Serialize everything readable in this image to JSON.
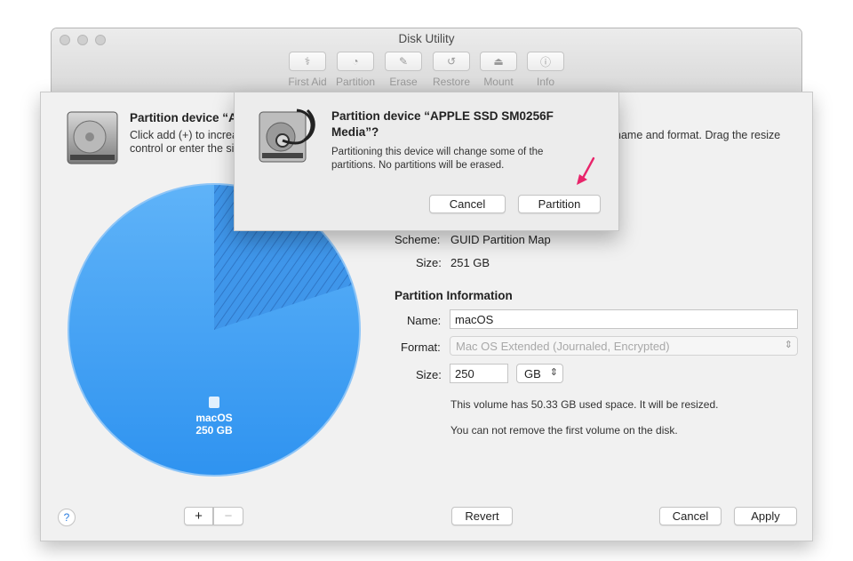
{
  "window": {
    "title": "Disk Utility",
    "toolbar": [
      {
        "label": "First Aid",
        "icon": "stethoscope-icon",
        "glyph": "⚕"
      },
      {
        "label": "Partition",
        "icon": "partition-icon",
        "glyph": "◔"
      },
      {
        "label": "Erase",
        "icon": "erase-icon",
        "glyph": "✎"
      },
      {
        "label": "Restore",
        "icon": "restore-icon",
        "glyph": "↺"
      },
      {
        "label": "Mount",
        "icon": "mount-icon",
        "glyph": "⏏"
      },
      {
        "label": "Info",
        "icon": "info-icon",
        "glyph": "ⓘ"
      }
    ]
  },
  "sheet": {
    "heading": "Partition device “A",
    "desc_line1": "Click add (+) to increa",
    "desc_line2": "control or enter the siz",
    "desc_right": "name and format. Drag the resize",
    "pie": {
      "volume_name": "macOS",
      "volume_size": "250 GB",
      "used_fraction": 0.2,
      "colors": {
        "fill": "#4aa6f6",
        "used": "#2f7fd6",
        "border": "#8ec5f7"
      }
    },
    "scheme_label": "Scheme:",
    "scheme_value": "GUID Partition Map",
    "size_label": "Size:",
    "size_value": "251 GB",
    "partition_info_title": "Partition Information",
    "name_label": "Name:",
    "name_value": "macOS",
    "format_label": "Format:",
    "format_value": "Mac OS Extended (Journaled, Encrypted)",
    "psize_label": "Size:",
    "psize_value": "250",
    "psize_unit": "GB",
    "note1": "This volume has 50.33 GB used space. It will be resized.",
    "note2": "You can not remove the first volume on the disk.",
    "help_label": "?",
    "add_label": "+",
    "remove_label": "−",
    "revert_label": "Revert",
    "cancel_label": "Cancel",
    "apply_label": "Apply"
  },
  "dialog": {
    "title_line1": "Partition device “APPLE SSD SM0256F",
    "title_line2": "Media”?",
    "message_line1": "Partitioning this device will change some of the",
    "message_line2": "partitions. No partitions will be erased.",
    "cancel_label": "Cancel",
    "partition_label": "Partition",
    "arrow_color": "#e8246a"
  }
}
